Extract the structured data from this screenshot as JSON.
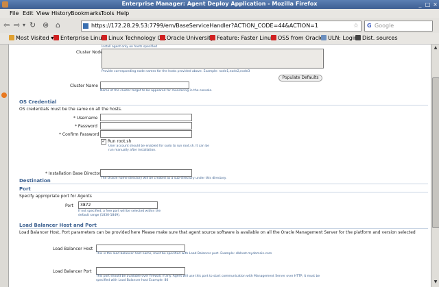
{
  "window": {
    "title": "Enterprise Manager: Agent Deploy Application - Mozilla Firefox"
  },
  "menu": [
    "File",
    "Edit",
    "View",
    "History",
    "Bookmarks",
    "Tools",
    "Help"
  ],
  "nav": {
    "url": "https://172.28.29.53:7799/em/BaseServiceHandler?ACTION_CODE=44&ACTION=1",
    "search_placeholder": "Google"
  },
  "bookmarks": [
    "Most Visited",
    "Enterprise Linux",
    "Linux Technology C...",
    "Oracle University",
    "Feature: Faster Linu...",
    "OSS from Oracle",
    "ULN: Login",
    "Dist. sources"
  ],
  "form": {
    "top_hint": "Install agent only on hosts specified",
    "cluster_node_list_label": "Cluster Node List",
    "cluster_node_list_hint": "Provide corresponding node names for the hosts provided above. Example: node1,node2,node3",
    "populate_defaults": "Populate Defaults",
    "cluster_name_label": "Cluster Name",
    "cluster_name_hint": "Name of the cluster target to be appeared for monitoring in the console.",
    "os_section": "OS Credential",
    "os_desc": "OS credentials must be the same on all the hosts.",
    "username_label": "* Username",
    "password_label": "* Password",
    "confirm_label": "* Confirm Password",
    "run_root": "Run root.sh",
    "run_root_hint": "User account should be enabled for sudo to run root.sh. It can be run manually after installation.",
    "dest_section": "Destination",
    "install_dir_label": "* Installation Base Directory",
    "install_dir_hint": "The Oracle home directory will be created as a sub-directory under this directory.",
    "port_section": "Port",
    "port_desc": "Specify appropriate port for Agents",
    "port_label": "Port",
    "port_value": "3872",
    "port_hint": "If not specified, a free port will be selected within the default range (1830-1849).",
    "lb_section": "Load Balancer Host and Port",
    "lb_desc": "Load Balancer Host, Port parameters can be provided here Please make sure that agent source software is available on all the Oracle Management Server for the platform and version selected",
    "lb_host_label": "Load Balancer Host",
    "lb_host_hint": "This is the load balancer host name, must be specified with Load Balancer port. Example: slbhost.mydomain.com",
    "lb_port_label": "Load Balancer Port",
    "lb_port_hint": "This port should be available over firewall, if any. Agent will use this port to start communication with Management Server over HTTP, it must be specified with Load Balancer host Example: 80"
  }
}
